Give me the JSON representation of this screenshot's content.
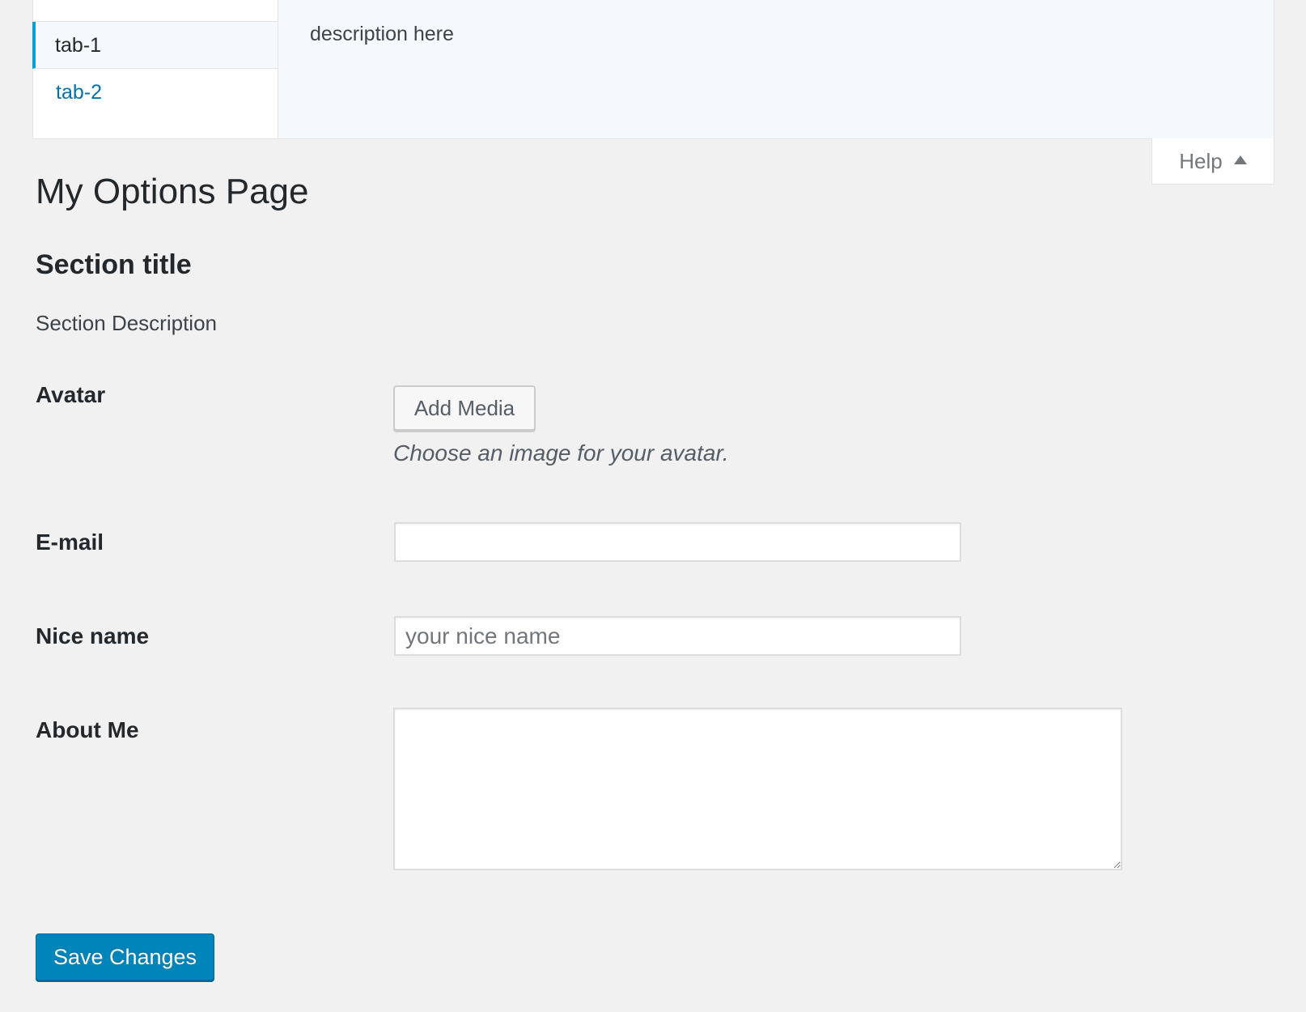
{
  "help": {
    "tabs": [
      {
        "label": "tab-1",
        "active": true
      },
      {
        "label": "tab-2",
        "active": false
      }
    ],
    "content": "description here",
    "toggle_label": "Help",
    "toggle_icon": "caret-up-icon"
  },
  "page": {
    "title": "My Options Page"
  },
  "section": {
    "title": "Section title",
    "description": "Section Description"
  },
  "fields": {
    "avatar": {
      "label": "Avatar",
      "button_label": "Add Media",
      "description": "Choose an image for your avatar."
    },
    "email": {
      "label": "E-mail",
      "value": "",
      "placeholder": ""
    },
    "nice_name": {
      "label": "Nice name",
      "value": "",
      "placeholder": "your nice name"
    },
    "about_me": {
      "label": "About Me",
      "value": ""
    }
  },
  "actions": {
    "save_label": "Save Changes"
  },
  "colors": {
    "background": "#f1f1f1",
    "primary": "#0085ba",
    "link": "#0073aa",
    "active_tab_border": "#00a0d2"
  }
}
